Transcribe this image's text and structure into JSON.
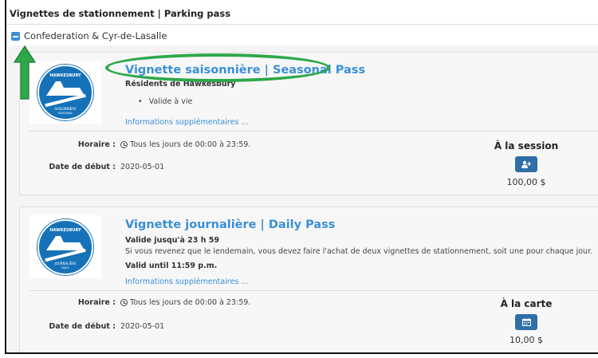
{
  "header": {
    "title": "Vignettes de stationnement | Parking pass"
  },
  "location": {
    "name": "Confederation & Cyr-de-Lasalle"
  },
  "cards": [
    {
      "badge": {
        "brand": "HAWKESBURY",
        "line1": "SAISONNIÈRE",
        "line2": "SEASONAL"
      },
      "title": "Vignette saisonnière | Seasonal Pass",
      "subtitle": "Résidents de Hawkesbury",
      "bullet": "Valide à vie",
      "more_link": "Informations supplémentaires ...",
      "schedule_label": "Horaire :",
      "schedule_value": "Tous les jours de 00:00 à 23:59.",
      "start_label": "Date de début :",
      "start_value": "2020-05-01",
      "price_heading": "À la session",
      "button_icon": "add-user-icon",
      "price": "100,00 $"
    },
    {
      "badge": {
        "brand": "HAWKESBURY",
        "line1": "JOURNALIÈRE",
        "line2": "DAILY"
      },
      "title": "Vignette journalière | Daily Pass",
      "subtitle": "Valide jusqu'à 23 h 59",
      "text1": "Si vous revenez que le lendemain, vous devez faire l'achat de deux vignettes de stationnement, soit une pour chaque jour.",
      "subtitle2": "Valid until 11:59 p.m.",
      "more_link": "Informations supplémentaires ...",
      "schedule_label": "Horaire :",
      "schedule_value": "Tous les jours de 00:00 à 23:59.",
      "start_label": "Date de début :",
      "start_value": "2020-05-01",
      "price_heading": "À la carte",
      "button_icon": "calendar-icon",
      "price": "10,00 $"
    }
  ],
  "colors": {
    "accent": "#3a8fd8",
    "button": "#2f6ea8",
    "highlight": "#2ea84a"
  }
}
